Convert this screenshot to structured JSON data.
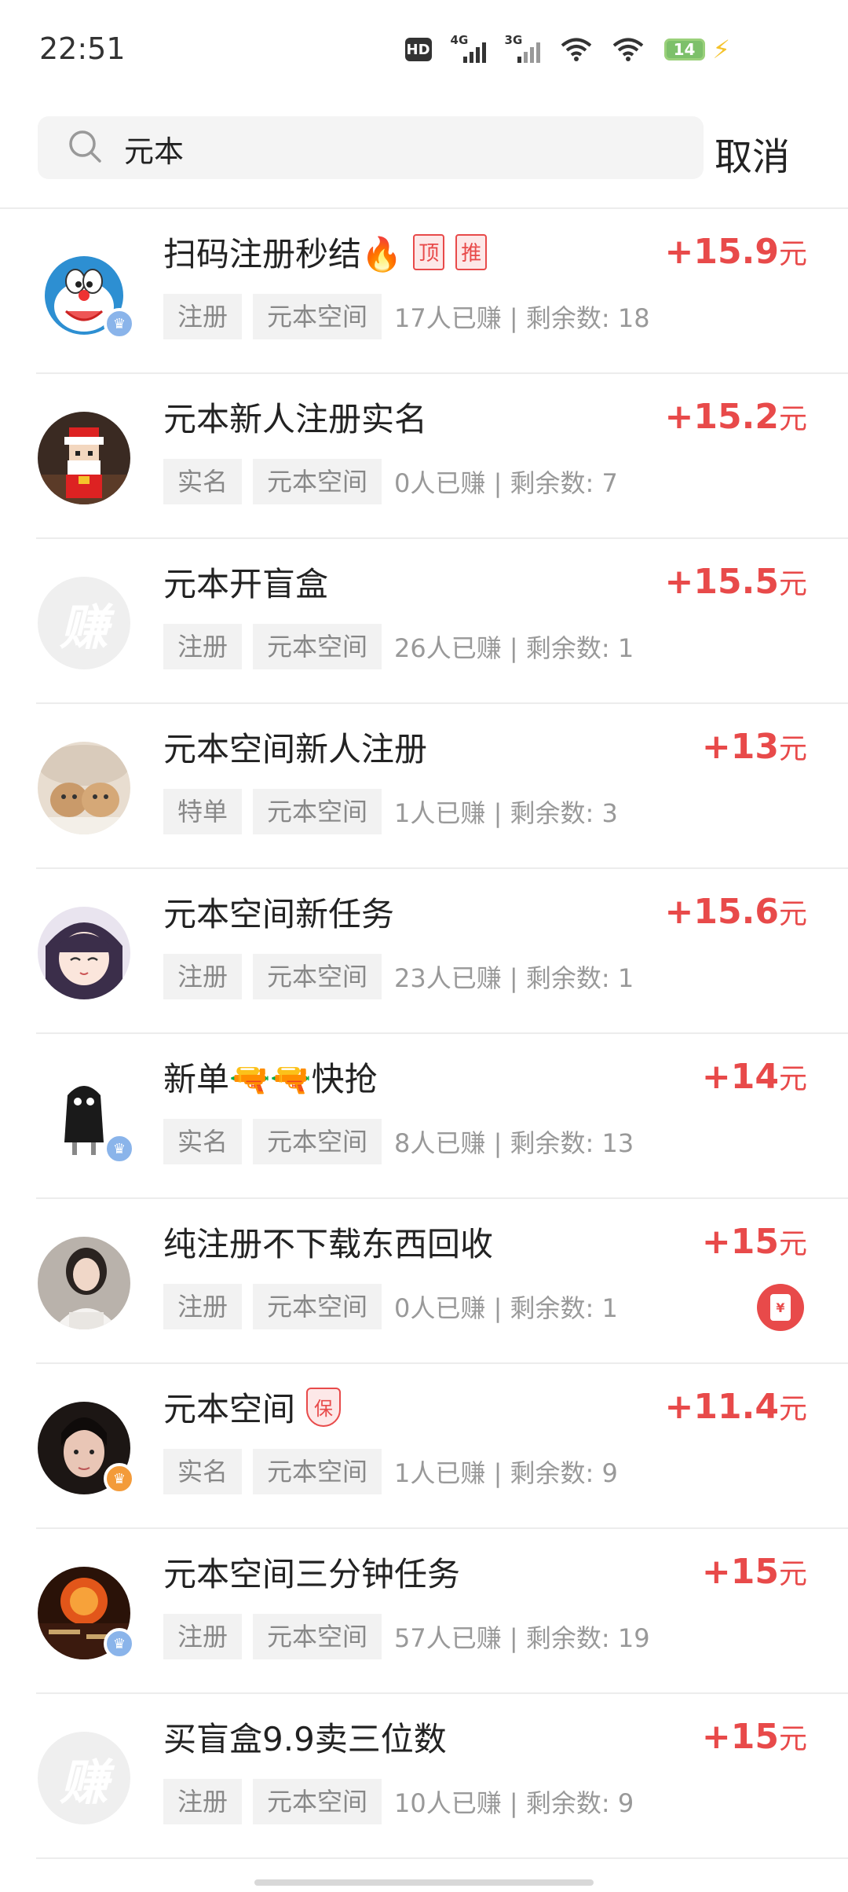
{
  "status_bar": {
    "time": "22:51",
    "hd_label": "HD",
    "signal1_label": "4G",
    "signal2_label": "3G",
    "battery_level": "14"
  },
  "search": {
    "query": "元本",
    "placeholder": "",
    "cancel_label": "取消"
  },
  "colors": {
    "accent_red": "#e84a4a",
    "tag_bg": "#f2f2f2",
    "badge_blue": "#8ab4ea",
    "badge_orange": "#f39b3a"
  },
  "tasks": [
    {
      "title": "扫码注册秒结🔥",
      "badges": [
        "顶",
        "推"
      ],
      "tags": [
        "注册",
        "元本空间"
      ],
      "stats": "17人已赚 | 剩余数: 18",
      "reward": "+15.9",
      "unit": "元"
    },
    {
      "title": "元本新人注册实名",
      "tags": [
        "实名",
        "元本空间"
      ],
      "stats": "0人已赚 | 剩余数: 7",
      "reward": "+15.2",
      "unit": "元"
    },
    {
      "title": "元本开盲盒",
      "avatar_text": "赚",
      "tags": [
        "注册",
        "元本空间"
      ],
      "stats": "26人已赚 | 剩余数: 1",
      "reward": "+15.5",
      "unit": "元"
    },
    {
      "title": "元本空间新人注册",
      "tags": [
        "特单",
        "元本空间"
      ],
      "stats": "1人已赚 | 剩余数: 3",
      "reward": "+13",
      "unit": "元"
    },
    {
      "title": "元本空间新任务",
      "tags": [
        "注册",
        "元本空间"
      ],
      "stats": "23人已赚 | 剩余数: 1",
      "reward": "+15.6",
      "unit": "元"
    },
    {
      "title": "新单🔫🔫快抢",
      "tags": [
        "实名",
        "元本空间"
      ],
      "stats": "8人已赚 | 剩余数: 13",
      "reward": "+14",
      "unit": "元"
    },
    {
      "title": "纯注册不下载东西回收",
      "tags": [
        "注册",
        "元本空间"
      ],
      "stats": "0人已赚 | 剩余数: 1",
      "reward": "+15",
      "unit": "元",
      "redpacket_symbol": "¥"
    },
    {
      "title": "元本空间",
      "shield_badge": "保",
      "tags": [
        "实名",
        "元本空间"
      ],
      "stats": "1人已赚 | 剩余数: 9",
      "reward": "+11.4",
      "unit": "元"
    },
    {
      "title": "元本空间三分钟任务",
      "tags": [
        "注册",
        "元本空间"
      ],
      "stats": "57人已赚 | 剩余数: 19",
      "reward": "+15",
      "unit": "元"
    },
    {
      "title": "买盲盒9.9卖三位数",
      "avatar_text": "赚",
      "tags": [
        "注册",
        "元本空间"
      ],
      "stats": "10人已赚 | 剩余数: 9",
      "reward": "+15",
      "unit": "元"
    }
  ]
}
